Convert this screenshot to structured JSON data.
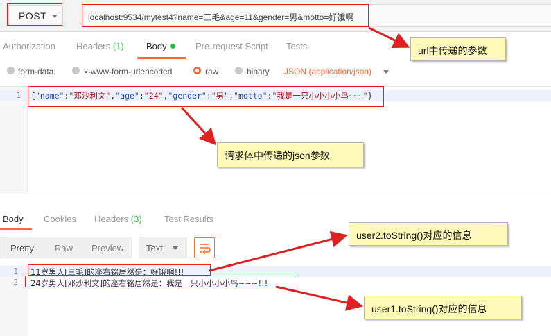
{
  "request": {
    "method": "POST",
    "url": "localhost:9534/mytest4?name=三毛&age=11&gender=男&motto=好饿啊"
  },
  "request_tabs": [
    {
      "label": "Authorization"
    },
    {
      "label": "Headers",
      "count": "(1)"
    },
    {
      "label": "Body",
      "active": true
    },
    {
      "label": "Pre-request Script"
    },
    {
      "label": "Tests"
    }
  ],
  "body_types": {
    "form_data": "form-data",
    "urlencoded": "x-www-form-urlencoded",
    "raw": "raw",
    "binary": "binary",
    "content_type": "JSON (application/json)"
  },
  "editor": {
    "line_numbers": [
      "1"
    ],
    "line1": {
      "open": "{",
      "k1": "\"name\"",
      "c1": ":",
      "v1": "\"邓沙利文\"",
      "s1": ",",
      "k2": "\"age\"",
      "c2": ":",
      "v2": "\"24\"",
      "s2": ",",
      "k3": "\"gender\"",
      "c3": ":",
      "v3": "\"男\"",
      "s3": ",",
      "k4": "\"motto\"",
      "c4": ":",
      "v4": "\"我是一只小小小小鸟~~~\"",
      "close": "}"
    }
  },
  "response_tabs": [
    {
      "label": "Body",
      "active": true
    },
    {
      "label": "Cookies"
    },
    {
      "label": "Headers",
      "count": "(3)"
    },
    {
      "label": "Test Results"
    }
  ],
  "response_toolbar": {
    "pretty": "Pretty",
    "raw": "Raw",
    "preview": "Preview",
    "format": "Text"
  },
  "response_body": {
    "line_numbers": [
      "1",
      "2"
    ],
    "lines": [
      "11岁男人[三毛]的座右铭居然是：好饿啊!!!",
      "24岁男人[邓沙利文]的座右铭居然是：我是一只小小小小鸟~~~!!!"
    ]
  },
  "annotations": {
    "url_params": "url中传递的参数",
    "json_params": "请求体中传递的json参数",
    "user2": "user2.toString()对应的信息",
    "user1": "user1.toString()对应的信息"
  },
  "colors": {
    "accent": "#f26b3a",
    "annotation_red": "#e02020",
    "callout_bg": "#fffaba",
    "count_green": "#39b54a"
  },
  "icons": [
    "method-caret-icon",
    "status-dot-icon",
    "radio-icon",
    "content-type-caret-icon",
    "format-caret-icon",
    "wrap-lines-icon",
    "annotation-arrow-icon"
  ]
}
